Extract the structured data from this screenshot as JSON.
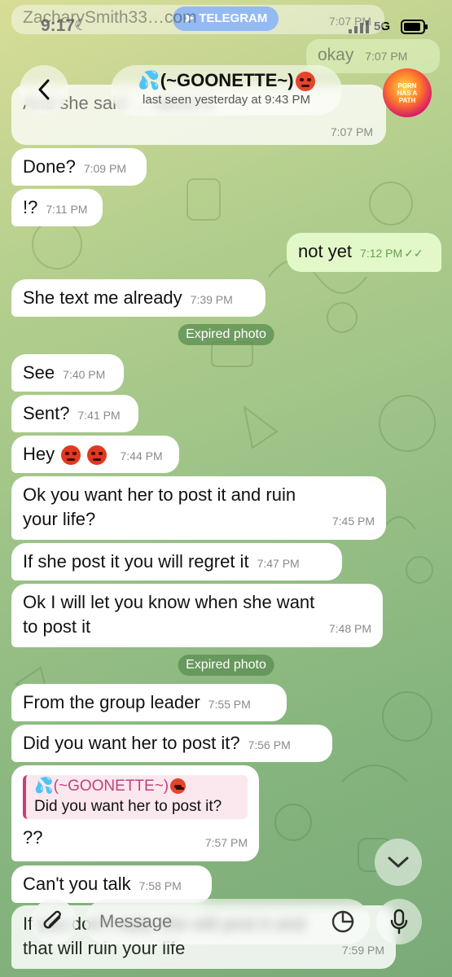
{
  "status": {
    "time": "9:17",
    "banner": "TELEGRAM",
    "network": "5G"
  },
  "header": {
    "title": "(~GOONETTE~)",
    "subtitle": "last seen yesterday at 9:43 PM",
    "avatar_text": "PORN HAS A PATH"
  },
  "ghost_top": {
    "email": "ZacharySmith33…com",
    "email_time": "7:07 PM",
    "okay_text": "okay",
    "okay_time": "7:07 PM",
    "partial_text": "And she said … about it",
    "partial_time": "7:07 PM"
  },
  "messages": [
    {
      "text": "Done?",
      "time": "7:09 PM"
    },
    {
      "text": "!?",
      "time": "7:11 PM"
    },
    {
      "text": "not yet",
      "time": "7:12 PM"
    },
    {
      "text": "She text me already",
      "time": "7:39 PM"
    },
    {
      "text": "See",
      "time": "7:40 PM"
    },
    {
      "text": "Sent?",
      "time": "7:41 PM"
    },
    {
      "text": "Hey",
      "time": "7:44 PM"
    },
    {
      "text": "Ok you want her to post it and ruin your life?",
      "time": "7:45 PM"
    },
    {
      "text": "If she post it you will regret it",
      "time": "7:47 PM"
    },
    {
      "text": "Ok I will let you know when she want to post it",
      "time": "7:48 PM"
    },
    {
      "text": "From the group leader",
      "time": "7:55 PM"
    },
    {
      "text": "Did you want her to post it?",
      "time": "7:56 PM"
    },
    {
      "text": "??",
      "time": "7:57 PM",
      "reply_name": "(~GOONETTE~)",
      "reply_text": "Did you want her to post it?"
    },
    {
      "text": "Can't you talk",
      "time": "7:58 PM"
    },
    {
      "text": "If you don't reply she will post it and that will ruin your life",
      "time": "7:59 PM"
    }
  ],
  "service": {
    "expired1": "Expired photo",
    "expired2": "Expired photo"
  },
  "composer": {
    "placeholder": "Message"
  },
  "colors": {
    "incoming_bubble": "#ffffff",
    "outgoing_bubble": "#e3f8c8",
    "accent_green": "#5fa24d",
    "reply_accent": "#c2417a"
  }
}
